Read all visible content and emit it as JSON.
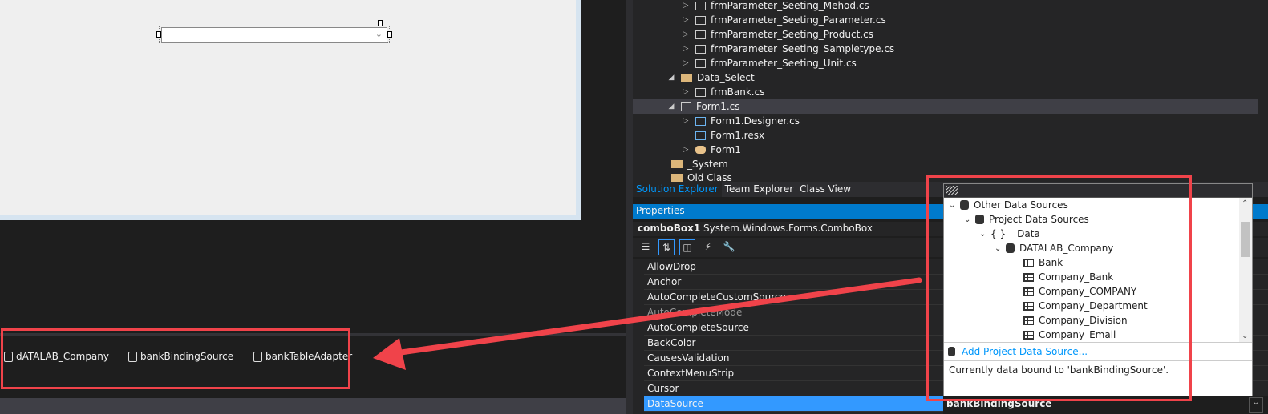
{
  "solution_explorer": {
    "items": [
      {
        "label": "frmParameter_Seeting_Mehod.cs",
        "kind": "form",
        "expander": "collapsed"
      },
      {
        "label": "frmParameter_Seeting_Parameter.cs",
        "kind": "form",
        "expander": "collapsed"
      },
      {
        "label": "frmParameter_Seeting_Product.cs",
        "kind": "form",
        "expander": "collapsed"
      },
      {
        "label": "frmParameter_Seeting_Sampletype.cs",
        "kind": "form",
        "expander": "collapsed"
      },
      {
        "label": "frmParameter_Seeting_Unit.cs",
        "kind": "form",
        "expander": "collapsed"
      },
      {
        "label": "Data_Select",
        "kind": "folder-open",
        "expander": "expanded"
      },
      {
        "label": "frmBank.cs",
        "kind": "form",
        "expander": "collapsed"
      },
      {
        "label": "Form1.cs",
        "kind": "form",
        "expander": "expanded",
        "selected": true
      },
      {
        "label": "Form1.Designer.cs",
        "kind": "code",
        "expander": "collapsed"
      },
      {
        "label": "Form1.resx",
        "kind": "code",
        "expander": "none"
      },
      {
        "label": "Form1",
        "kind": "class",
        "expander": "collapsed"
      },
      {
        "label": "_System",
        "kind": "folder",
        "expander": "none"
      },
      {
        "label": "Old Class",
        "kind": "folder",
        "expander": "none"
      }
    ],
    "tabs": [
      "Solution Explorer",
      "Team Explorer",
      "Class View"
    ],
    "active_tab": "Solution Explorer"
  },
  "properties": {
    "title": "Properties",
    "object_name": "comboBox1",
    "object_type": "System.Windows.Forms.ComboBox",
    "rows": [
      "AllowDrop",
      "Anchor",
      "AutoCompleteCustomSource",
      "AutoCompleteMode",
      "AutoCompleteSource",
      "BackColor",
      "CausesValidation",
      "ContextMenuStrip",
      "Cursor",
      "DataSource"
    ],
    "selected_row": "DataSource",
    "datasource_value": "bankBindingSource"
  },
  "popup": {
    "tree": [
      {
        "label": "Other Data Sources",
        "icon": "database-multi-icon",
        "expanded": true
      },
      {
        "label": "Project Data Sources",
        "icon": "database-icon",
        "expanded": true
      },
      {
        "label": "_Data",
        "icon": "namespace-icon",
        "icon_text": "{ }",
        "expanded": true
      },
      {
        "label": "DATALAB_Company",
        "icon": "dataset-icon",
        "expanded": true
      },
      {
        "label": "Bank",
        "icon": "table-icon"
      },
      {
        "label": "Company_Bank",
        "icon": "table-icon"
      },
      {
        "label": "Company_COMPANY",
        "icon": "table-icon"
      },
      {
        "label": "Company_Department",
        "icon": "table-icon"
      },
      {
        "label": "Company_Division",
        "icon": "table-icon"
      },
      {
        "label": "Company_Email",
        "icon": "table-icon"
      }
    ],
    "add_link": "Add Project Data Source...",
    "description": "Currently data bound to 'bankBindingSource'."
  },
  "tray": {
    "items": [
      "dATALAB_Company",
      "bankBindingSource",
      "bankTableAdapter"
    ]
  },
  "colors": {
    "accent": "#007acc",
    "selection": "#3399ff",
    "annotation": "#f0434a",
    "link": "#0097fb"
  }
}
